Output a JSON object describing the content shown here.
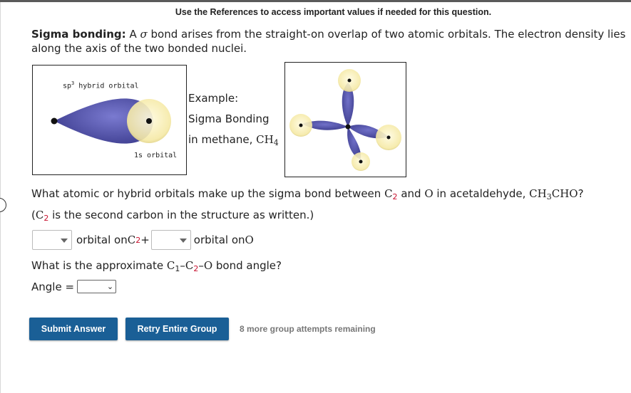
{
  "header": {
    "references_note": "Use the References to access important values if needed for this question."
  },
  "intro": {
    "title": "Sigma bonding:",
    "text_before_symbol": " A ",
    "sigma_symbol": "σ",
    "text_after_symbol": " bond arises from the straight-on overlap of two atomic orbitals. The electron density lies along the axis of the two bonded nuclei."
  },
  "figure_left": {
    "label_top_prefix": "sp",
    "label_top_sup": "3",
    "label_top_suffix": " hybrid orbital",
    "label_bottom": "1s orbital",
    "colors": {
      "lobe": "#4f4fa0",
      "s_orbital": "#f8f0b0",
      "nucleus": "#111111"
    }
  },
  "example": {
    "line1": "Example:",
    "line2": "Sigma Bonding",
    "line3_prefix": "in methane, ",
    "formula_main": "CH",
    "formula_sub": "4"
  },
  "question1": {
    "text1": "What atomic or hybrid orbitals make up the sigma bond between ",
    "atom1": "C",
    "atom1_sub": "2",
    "and": " and ",
    "atom2": "O",
    "text2": " in acetaldehyde, ",
    "formula_a": "CH",
    "formula_a_sub": "3",
    "formula_b": "CHO",
    "end": "?",
    "note_open": "(",
    "note_atom": "C",
    "note_sub": "2",
    "note_text": " is the second carbon in the structure as written.)"
  },
  "orbital_row": {
    "dropdown1_value": "",
    "label1": " orbital on ",
    "atom1": "C",
    "atom1_sub": "2",
    "plus": " + ",
    "dropdown2_value": "",
    "label2": " orbital on ",
    "atom2": "O"
  },
  "question2": {
    "text1": "What is the approximate ",
    "c1": "C",
    "c1_sub": "1",
    "dash1": "–",
    "c2": "C",
    "c2_sub": "2",
    "dash2": "–",
    "o": "O",
    "text2": " bond angle?"
  },
  "angle": {
    "label": "Angle =",
    "selected": ""
  },
  "buttons": {
    "submit": "Submit Answer",
    "retry": "Retry Entire Group"
  },
  "attempts": "8 more group attempts remaining",
  "colors": {
    "button_bg": "#1a5f96",
    "highlight_red": "#c8102e",
    "lobe": "#4f4fa0",
    "s_orbital": "#f8f0b0"
  }
}
